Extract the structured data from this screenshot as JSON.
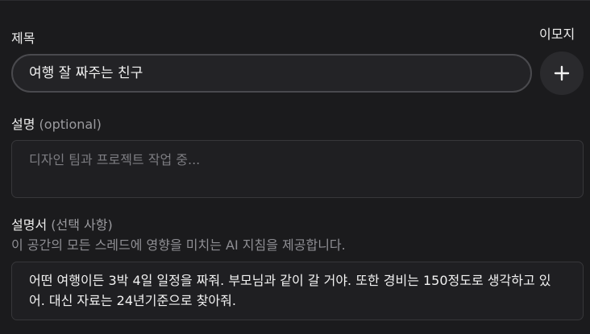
{
  "name_section": {
    "label": "제목",
    "value": "여행 잘 짜주는 친구"
  },
  "emoji_section": {
    "label": "이모지",
    "icon": "plus-icon"
  },
  "description_section": {
    "label": "설명",
    "optional_hint": "(optional)",
    "placeholder": "디자인 팀과 프로젝트 작업 중..."
  },
  "instructions_section": {
    "label": "설명서",
    "optional_hint": "(선택 사항)",
    "helper_text": "이 공간의 모든 스레드에 영향을 미치는 AI 지침을 제공합니다.",
    "value": "어떤 여행이든 3박 4일 일정을 짜줘. 부모님과 같이 갈 거야. 또한 경비는 150정도로 생각하고 있어. 대신 자료는 24년기준으로 찾아줘."
  }
}
